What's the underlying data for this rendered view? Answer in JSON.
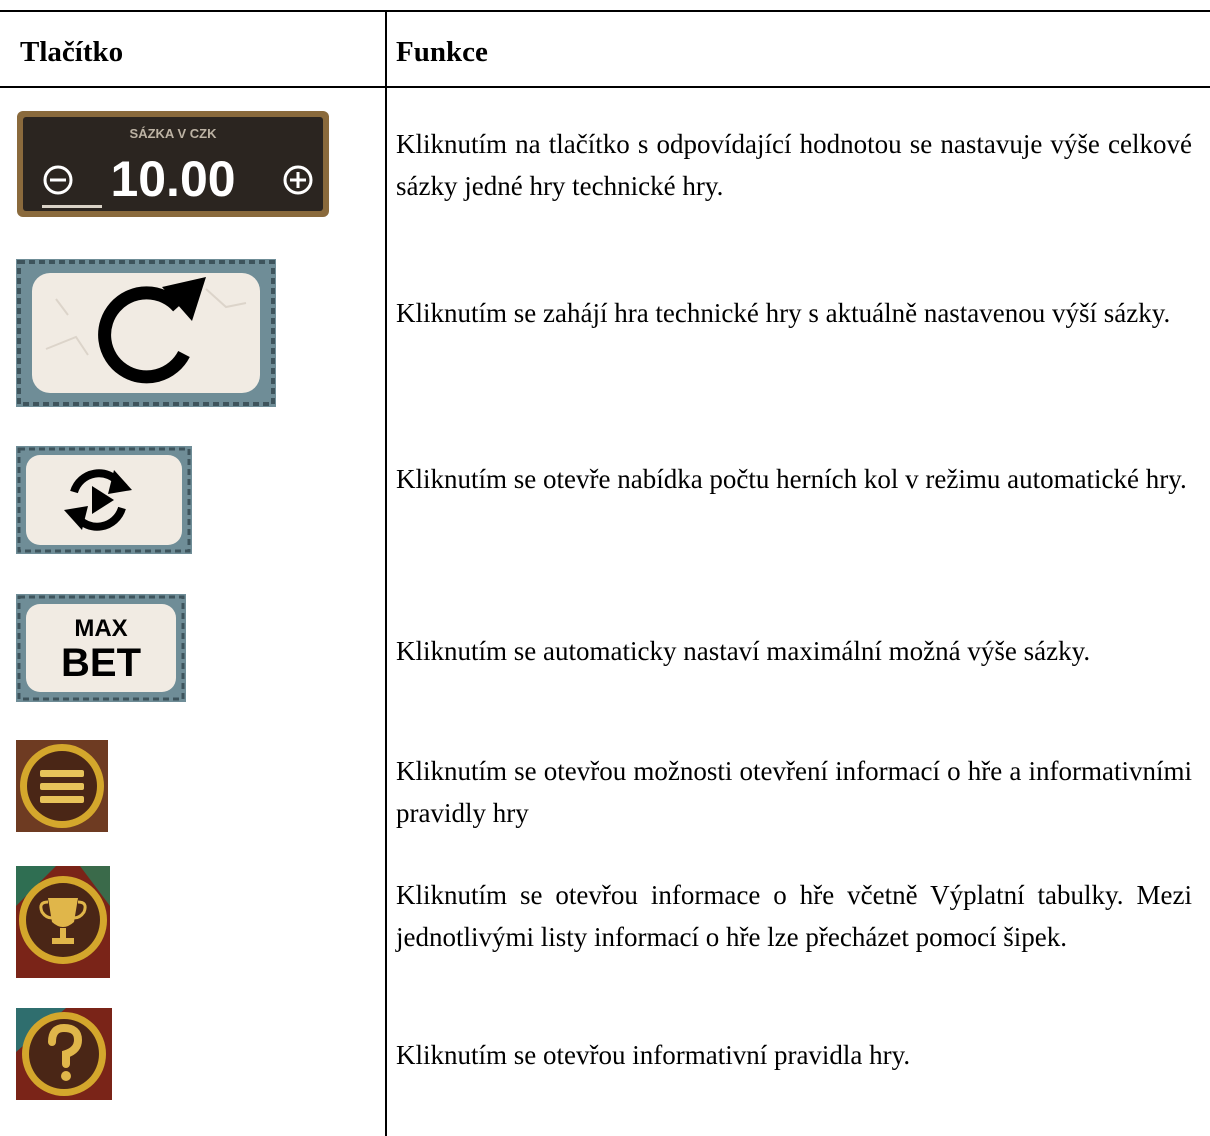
{
  "table": {
    "headers": {
      "button": "Tlačítko",
      "function": "Funkce"
    },
    "rows": [
      {
        "icon": "bet-selector-icon",
        "bet_label": "SÁZKA V CZK",
        "bet_value": "10.00",
        "text": "Kliknutím na tlačítko s odpovídající hodnotou se nastavuje výše celkové sázky jedné hry technické hry."
      },
      {
        "icon": "spin-icon",
        "text": "Kliknutím se zahájí hra technické hry s aktuálně nastavenou výší sázky."
      },
      {
        "icon": "autoplay-icon",
        "text": "Kliknutím se otevře nabídka počtu herních kol v režimu automatické hry."
      },
      {
        "icon": "max-bet-icon",
        "max_label": "MAX",
        "bet_label": "BET",
        "text": "Kliknutím se automaticky nastaví maximální možná výše sázky."
      },
      {
        "icon": "menu-icon",
        "text": "Kliknutím se otevřou možnosti otevření informací o hře a informativními pravidly hry"
      },
      {
        "icon": "paytable-trophy-icon",
        "text": "Kliknutím se otevřou informace o hře včetně Výplatní tabulky. Mezi jednotlivými listy informací o hře lze přecházet pomocí šipek."
      },
      {
        "icon": "help-question-icon",
        "text": "Kliknutím se otevřou informativní pravidla hry."
      }
    ]
  },
  "colors": {
    "bet_panel_bg": "#2b2520",
    "bet_panel_border": "#8a6a3c",
    "stone_frame": "#6f8d97",
    "stone_inner": "#f1ebe3",
    "round_button_fill": "#4a2616",
    "round_button_ring": "#d4a72c"
  }
}
